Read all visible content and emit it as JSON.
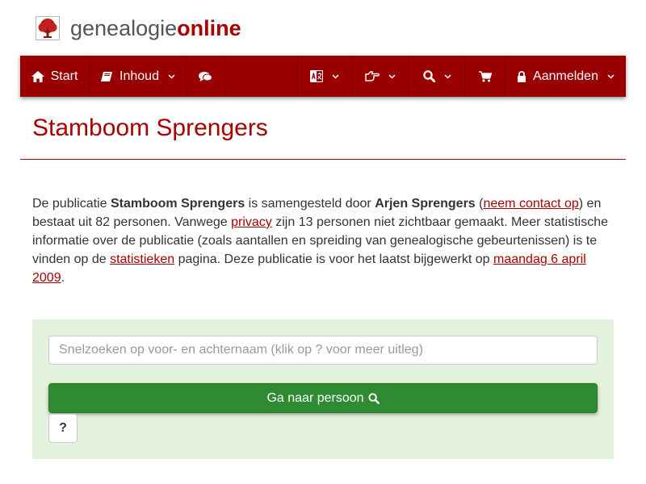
{
  "brand": {
    "text_main": "genealogie",
    "text_accent": "online",
    "logo_icon": "tree-logo"
  },
  "nav": {
    "start": "Start",
    "inhoud": "Inhoud",
    "aanmelden": "Aanmelden"
  },
  "page": {
    "title": "Stamboom Sprengers"
  },
  "intro": {
    "t1": "De publicatie ",
    "b1": "Stamboom Sprengers",
    "t2": " is samengesteld door ",
    "b2": "Arjen Sprengers",
    "t3": " (",
    "link_contact": "neem contact op",
    "t4": ") en bestaat uit 82 personen. Vanwege ",
    "link_privacy": "privacy",
    "t5": " zijn 13 personen niet zichtbaar gemaakt. Meer statistische informatie over de publicatie (zoals aantallen en spreiding van genealogische gebeurtenissen) is te vinden op de ",
    "link_stats": "statistieken",
    "t6": " pagina. Deze publicatie is voor het laatst bijgewerkt op ",
    "link_date": "maandag 6 april 2009",
    "t7": "."
  },
  "search": {
    "placeholder": "Snelzoeken op voor- en achternaam (klik op ? voor meer uitleg)",
    "go_label": "Ga naar persoon",
    "help_label": "?"
  },
  "colors": {
    "accent": "#a80000",
    "navbar": "#990000",
    "search_bg": "#e3f2dd",
    "go_button": "#2e8b32"
  }
}
